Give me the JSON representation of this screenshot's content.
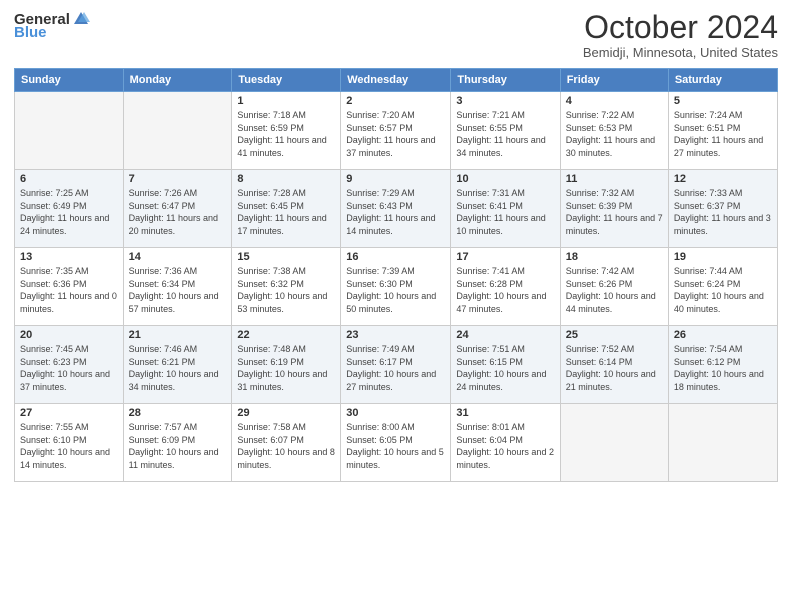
{
  "logo": {
    "general": "General",
    "blue": "Blue"
  },
  "header": {
    "title": "October 2024",
    "subtitle": "Bemidji, Minnesota, United States"
  },
  "weekdays": [
    "Sunday",
    "Monday",
    "Tuesday",
    "Wednesday",
    "Thursday",
    "Friday",
    "Saturday"
  ],
  "weeks": [
    [
      {
        "day": "",
        "detail": ""
      },
      {
        "day": "",
        "detail": ""
      },
      {
        "day": "1",
        "detail": "Sunrise: 7:18 AM\nSunset: 6:59 PM\nDaylight: 11 hours and 41 minutes."
      },
      {
        "day": "2",
        "detail": "Sunrise: 7:20 AM\nSunset: 6:57 PM\nDaylight: 11 hours and 37 minutes."
      },
      {
        "day": "3",
        "detail": "Sunrise: 7:21 AM\nSunset: 6:55 PM\nDaylight: 11 hours and 34 minutes."
      },
      {
        "day": "4",
        "detail": "Sunrise: 7:22 AM\nSunset: 6:53 PM\nDaylight: 11 hours and 30 minutes."
      },
      {
        "day": "5",
        "detail": "Sunrise: 7:24 AM\nSunset: 6:51 PM\nDaylight: 11 hours and 27 minutes."
      }
    ],
    [
      {
        "day": "6",
        "detail": "Sunrise: 7:25 AM\nSunset: 6:49 PM\nDaylight: 11 hours and 24 minutes."
      },
      {
        "day": "7",
        "detail": "Sunrise: 7:26 AM\nSunset: 6:47 PM\nDaylight: 11 hours and 20 minutes."
      },
      {
        "day": "8",
        "detail": "Sunrise: 7:28 AM\nSunset: 6:45 PM\nDaylight: 11 hours and 17 minutes."
      },
      {
        "day": "9",
        "detail": "Sunrise: 7:29 AM\nSunset: 6:43 PM\nDaylight: 11 hours and 14 minutes."
      },
      {
        "day": "10",
        "detail": "Sunrise: 7:31 AM\nSunset: 6:41 PM\nDaylight: 11 hours and 10 minutes."
      },
      {
        "day": "11",
        "detail": "Sunrise: 7:32 AM\nSunset: 6:39 PM\nDaylight: 11 hours and 7 minutes."
      },
      {
        "day": "12",
        "detail": "Sunrise: 7:33 AM\nSunset: 6:37 PM\nDaylight: 11 hours and 3 minutes."
      }
    ],
    [
      {
        "day": "13",
        "detail": "Sunrise: 7:35 AM\nSunset: 6:36 PM\nDaylight: 11 hours and 0 minutes."
      },
      {
        "day": "14",
        "detail": "Sunrise: 7:36 AM\nSunset: 6:34 PM\nDaylight: 10 hours and 57 minutes."
      },
      {
        "day": "15",
        "detail": "Sunrise: 7:38 AM\nSunset: 6:32 PM\nDaylight: 10 hours and 53 minutes."
      },
      {
        "day": "16",
        "detail": "Sunrise: 7:39 AM\nSunset: 6:30 PM\nDaylight: 10 hours and 50 minutes."
      },
      {
        "day": "17",
        "detail": "Sunrise: 7:41 AM\nSunset: 6:28 PM\nDaylight: 10 hours and 47 minutes."
      },
      {
        "day": "18",
        "detail": "Sunrise: 7:42 AM\nSunset: 6:26 PM\nDaylight: 10 hours and 44 minutes."
      },
      {
        "day": "19",
        "detail": "Sunrise: 7:44 AM\nSunset: 6:24 PM\nDaylight: 10 hours and 40 minutes."
      }
    ],
    [
      {
        "day": "20",
        "detail": "Sunrise: 7:45 AM\nSunset: 6:23 PM\nDaylight: 10 hours and 37 minutes."
      },
      {
        "day": "21",
        "detail": "Sunrise: 7:46 AM\nSunset: 6:21 PM\nDaylight: 10 hours and 34 minutes."
      },
      {
        "day": "22",
        "detail": "Sunrise: 7:48 AM\nSunset: 6:19 PM\nDaylight: 10 hours and 31 minutes."
      },
      {
        "day": "23",
        "detail": "Sunrise: 7:49 AM\nSunset: 6:17 PM\nDaylight: 10 hours and 27 minutes."
      },
      {
        "day": "24",
        "detail": "Sunrise: 7:51 AM\nSunset: 6:15 PM\nDaylight: 10 hours and 24 minutes."
      },
      {
        "day": "25",
        "detail": "Sunrise: 7:52 AM\nSunset: 6:14 PM\nDaylight: 10 hours and 21 minutes."
      },
      {
        "day": "26",
        "detail": "Sunrise: 7:54 AM\nSunset: 6:12 PM\nDaylight: 10 hours and 18 minutes."
      }
    ],
    [
      {
        "day": "27",
        "detail": "Sunrise: 7:55 AM\nSunset: 6:10 PM\nDaylight: 10 hours and 14 minutes."
      },
      {
        "day": "28",
        "detail": "Sunrise: 7:57 AM\nSunset: 6:09 PM\nDaylight: 10 hours and 11 minutes."
      },
      {
        "day": "29",
        "detail": "Sunrise: 7:58 AM\nSunset: 6:07 PM\nDaylight: 10 hours and 8 minutes."
      },
      {
        "day": "30",
        "detail": "Sunrise: 8:00 AM\nSunset: 6:05 PM\nDaylight: 10 hours and 5 minutes."
      },
      {
        "day": "31",
        "detail": "Sunrise: 8:01 AM\nSunset: 6:04 PM\nDaylight: 10 hours and 2 minutes."
      },
      {
        "day": "",
        "detail": ""
      },
      {
        "day": "",
        "detail": ""
      }
    ]
  ]
}
